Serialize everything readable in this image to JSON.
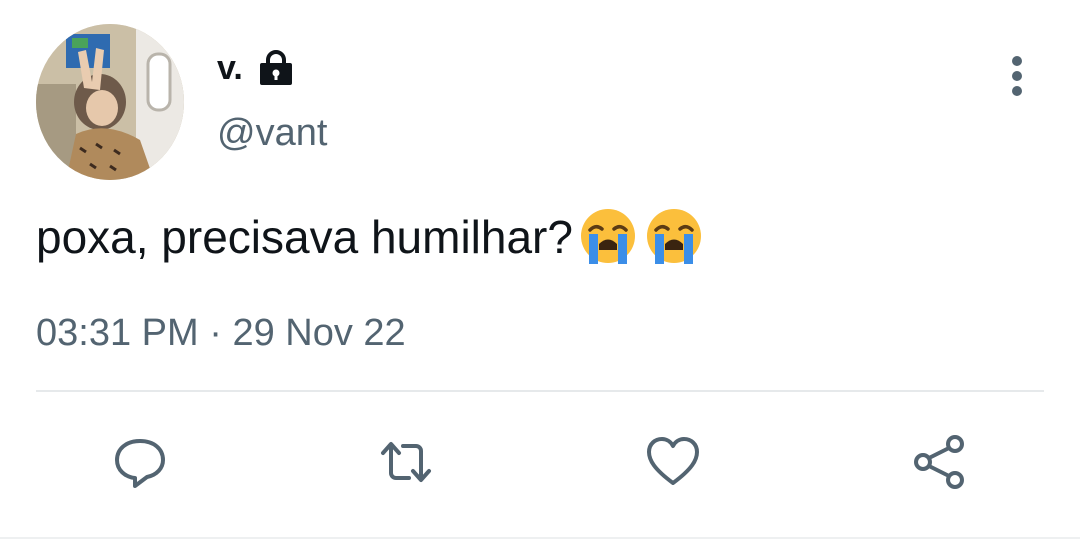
{
  "user": {
    "display_name": "v.",
    "handle": "@vant",
    "verified_lock": true
  },
  "tweet": {
    "text": "poxa, precisava humilhar?",
    "emojis": [
      "loudly-crying-face",
      "loudly-crying-face"
    ],
    "time": "03:31 PM",
    "separator": "·",
    "date": "29 Nov 22"
  },
  "actions": {
    "reply": "reply-icon",
    "retweet": "retweet-icon",
    "like": "heart-icon",
    "share": "share-icon"
  },
  "colors": {
    "text": "#0f1419",
    "secondary": "#536471",
    "divider": "#e6e9eb"
  }
}
